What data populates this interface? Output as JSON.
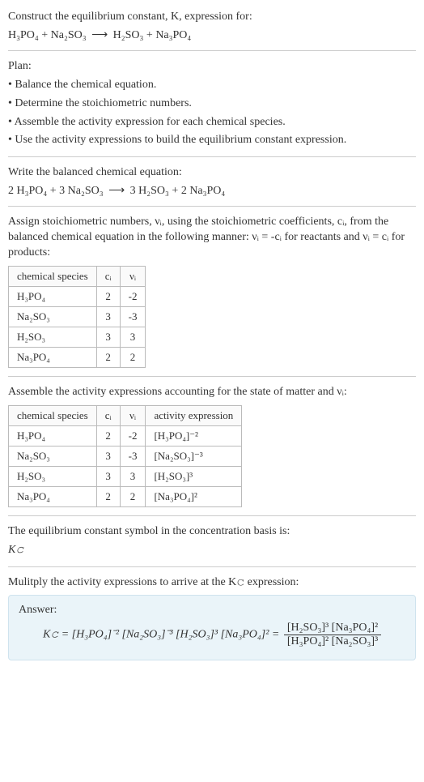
{
  "title_line1": "Construct the equilibrium constant, K, expression for:",
  "title_eqn_left": "H₃PO₄ + Na₂SO₃",
  "arrow": "⟶",
  "title_eqn_right": "H₂SO₃ + Na₃PO₄",
  "plan_header": "Plan:",
  "plan": [
    "• Balance the chemical equation.",
    "• Determine the stoichiometric numbers.",
    "• Assemble the activity expression for each chemical species.",
    "• Use the activity expressions to build the equilibrium constant expression."
  ],
  "balanced_intro": "Write the balanced chemical equation:",
  "balanced_left": "2 H₃PO₄ + 3 Na₂SO₃",
  "balanced_right": "3 H₂SO₃ + 2 Na₃PO₄",
  "assign_text": "Assign stoichiometric numbers, νᵢ, using the stoichiometric coefficients, cᵢ, from the balanced chemical equation in the following manner: νᵢ = -cᵢ for reactants and νᵢ = cᵢ for products:",
  "table1_headers": [
    "chemical species",
    "cᵢ",
    "νᵢ"
  ],
  "table1_rows": [
    [
      "H₃PO₄",
      "2",
      "-2"
    ],
    [
      "Na₂SO₃",
      "3",
      "-3"
    ],
    [
      "H₂SO₃",
      "3",
      "3"
    ],
    [
      "Na₃PO₄",
      "2",
      "2"
    ]
  ],
  "assemble_text": "Assemble the activity expressions accounting for the state of matter and νᵢ:",
  "table2_headers": [
    "chemical species",
    "cᵢ",
    "νᵢ",
    "activity expression"
  ],
  "table2_rows": [
    [
      "H₃PO₄",
      "2",
      "-2",
      "[H₃PO₄]⁻²"
    ],
    [
      "Na₂SO₃",
      "3",
      "-3",
      "[Na₂SO₃]⁻³"
    ],
    [
      "H₂SO₃",
      "3",
      "3",
      "[H₂SO₃]³"
    ],
    [
      "Na₃PO₄",
      "2",
      "2",
      "[Na₃PO₄]²"
    ]
  ],
  "symbol_text": "The equilibrium constant symbol in the concentration basis is:",
  "symbol_val": "K𝚌",
  "multiply_text": "Mulitply the activity expressions to arrive at the K𝚌 expression:",
  "answer_label": "Answer:",
  "answer_lhs": "K𝚌 = [H₃PO₄]⁻² [Na₂SO₃]⁻³ [H₂SO₃]³ [Na₃PO₄]² =",
  "answer_num": "[H₂SO₃]³ [Na₃PO₄]²",
  "answer_den": "[H₃PO₄]² [Na₂SO₃]³",
  "chart_data": {
    "type": "table",
    "title": "Stoichiometric numbers and activity expressions",
    "table1": {
      "columns": [
        "chemical species",
        "c_i",
        "nu_i"
      ],
      "rows": [
        {
          "species": "H3PO4",
          "c_i": 2,
          "nu_i": -2
        },
        {
          "species": "Na2SO3",
          "c_i": 3,
          "nu_i": -3
        },
        {
          "species": "H2SO3",
          "c_i": 3,
          "nu_i": 3
        },
        {
          "species": "Na3PO4",
          "c_i": 2,
          "nu_i": 2
        }
      ]
    },
    "table2": {
      "columns": [
        "chemical species",
        "c_i",
        "nu_i",
        "activity expression"
      ],
      "rows": [
        {
          "species": "H3PO4",
          "c_i": 2,
          "nu_i": -2,
          "activity": "[H3PO4]^-2"
        },
        {
          "species": "Na2SO3",
          "c_i": 3,
          "nu_i": -3,
          "activity": "[Na2SO3]^-3"
        },
        {
          "species": "H2SO3",
          "c_i": 3,
          "nu_i": 3,
          "activity": "[H2SO3]^3"
        },
        {
          "species": "Na3PO4",
          "c_i": 2,
          "nu_i": 2,
          "activity": "[Na3PO4]^2"
        }
      ]
    },
    "equilibrium_expression": "Kc = ([H2SO3]^3 * [Na3PO4]^2) / ([H3PO4]^2 * [Na2SO3]^3)"
  }
}
